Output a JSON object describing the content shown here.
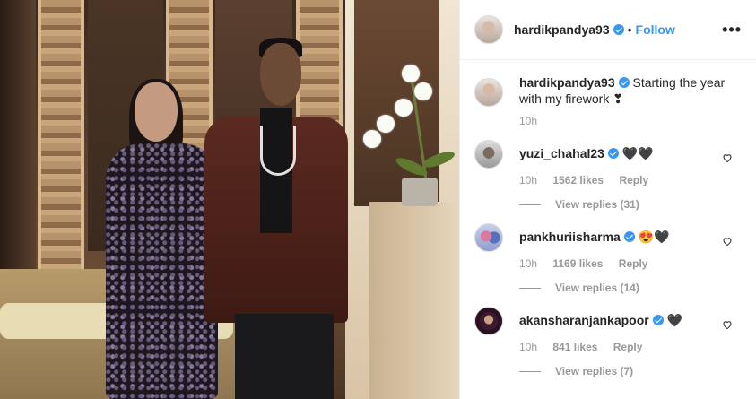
{
  "post": {
    "username": "hardikpandya93",
    "follow_label": "Follow",
    "more_label": "•••",
    "caption": "Starting the year with my firework ❣",
    "time": "10h"
  },
  "comments": [
    {
      "username": "yuzi_chahal23",
      "text": "🖤🖤",
      "time": "10h",
      "likes": "1562 likes",
      "reply": "Reply",
      "view_replies": "View replies (31)"
    },
    {
      "username": "pankhuriisharma",
      "text": "😍🖤",
      "time": "10h",
      "likes": "1169 likes",
      "reply": "Reply",
      "view_replies": "View replies (14)"
    },
    {
      "username": "akansharanjankapoor",
      "text": "🖤",
      "time": "10h",
      "likes": "841 likes",
      "reply": "Reply",
      "view_replies": "View replies (7)"
    }
  ],
  "colors": {
    "link": "#3897f0",
    "verified": "#3897f0",
    "muted": "#999999"
  },
  "icons": {
    "verified": "verified-badge-icon",
    "heart": "heart-icon",
    "more": "more-options-icon"
  }
}
